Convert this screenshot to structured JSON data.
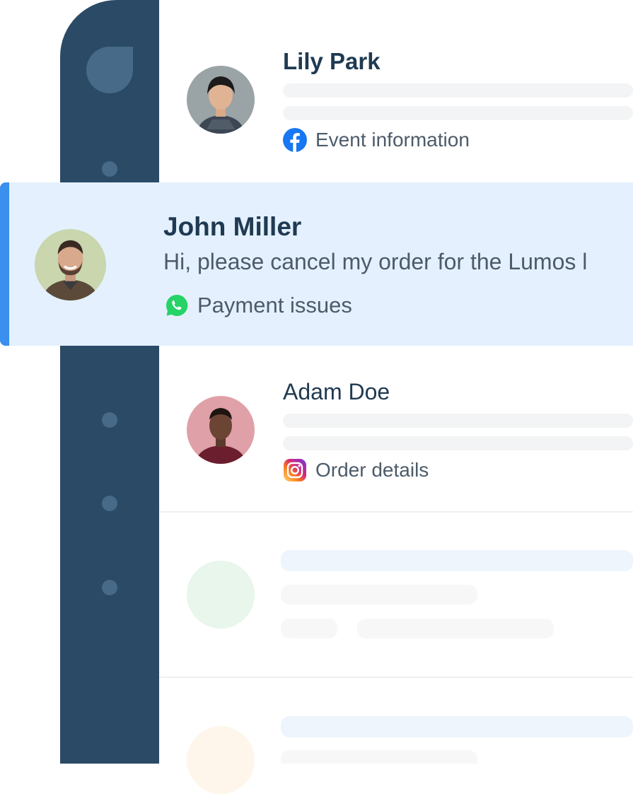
{
  "conversations": [
    {
      "name": "Lily Park",
      "channel": {
        "label": "Event information",
        "icon": "facebook-icon",
        "color": "#1877f2"
      }
    },
    {
      "name": "John Miller",
      "preview": "Hi, please cancel my order for the Lumos l",
      "channel": {
        "label": "Payment issues",
        "icon": "whatsapp-icon",
        "color": "#25d366"
      },
      "selected": true
    },
    {
      "name": "Adam Doe",
      "channel": {
        "label": "Order details",
        "icon": "instagram-icon",
        "color": "#e1306c"
      }
    }
  ],
  "colors": {
    "sidebar": "#2b4a65",
    "selected_background": "#e4f0fd",
    "selected_accent": "#3a8fef",
    "name_text": "#1f3a52"
  }
}
